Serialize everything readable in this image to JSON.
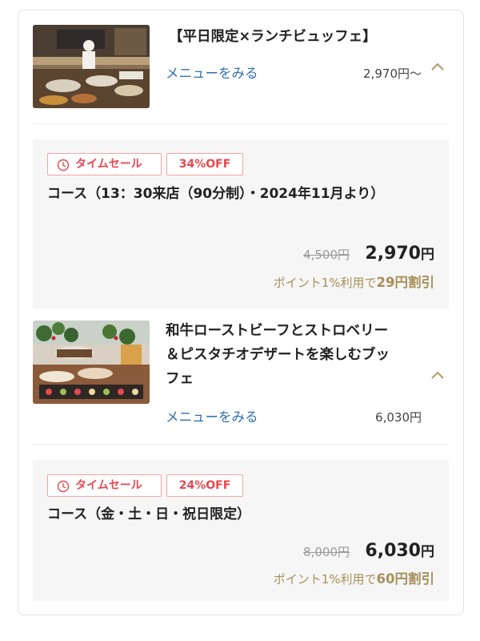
{
  "plans": [
    {
      "title": "【平日限定×ランチビュッフェ】",
      "menu_link": "メニューをみる",
      "price": "2,970円〜",
      "image_icon": "buffet-kitchen-photo",
      "toggle_icon": "chevron-up-icon",
      "course": {
        "time_sale_label": "タイムセール",
        "discount_label": "34%OFF",
        "title": "コース（13：30来店（90分制）・2024年11月より）",
        "original_price": "4,500円",
        "sale_price_number": "2,970",
        "sale_price_unit": "円",
        "point_prefix": "ポイント1%利用で",
        "point_amount": "29円割引"
      }
    },
    {
      "title_lines": [
        "和牛ローストビーフとストロベリー",
        "＆ピスタチオデザートを楽しむブッ",
        "フェ"
      ],
      "menu_link": "メニューをみる",
      "price": "6,030円",
      "image_icon": "dessert-buffet-photo",
      "toggle_icon": "chevron-up-icon",
      "course": {
        "time_sale_label": "タイムセール",
        "discount_label": "24%OFF",
        "title": "コース（金・土・日・祝日限定）",
        "original_price": "8,000円",
        "sale_price_number": "6,030",
        "sale_price_unit": "円",
        "point_prefix": "ポイント1%利用で",
        "point_amount": "60円割引"
      }
    }
  ],
  "colors": {
    "link": "#2f6fb0",
    "sale_red": "#e8474e",
    "badge_border": "#f2a5a5",
    "point_gold": "#a8905a",
    "chevron": "#b59a62",
    "course_bg": "#f6f6f6"
  }
}
